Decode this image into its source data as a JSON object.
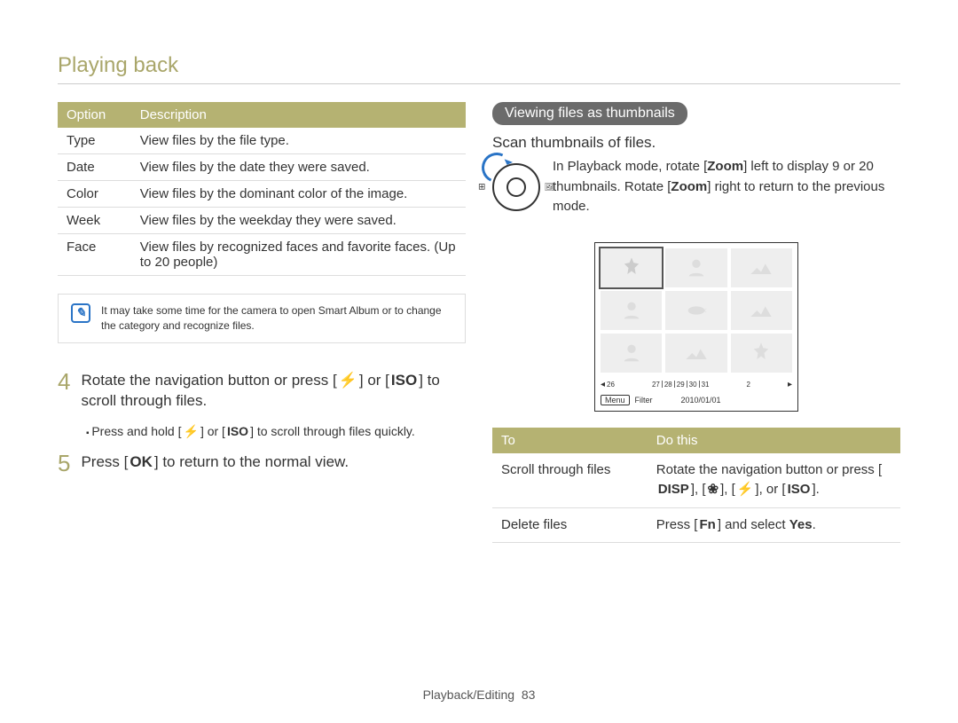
{
  "header": {
    "title": "Playing back"
  },
  "options_table": {
    "headers": [
      "Option",
      "Description"
    ],
    "rows": [
      {
        "option": "Type",
        "desc": "View files by the file type."
      },
      {
        "option": "Date",
        "desc": "View files by the date they were saved."
      },
      {
        "option": "Color",
        "desc": "View files by the dominant color of the image."
      },
      {
        "option": "Week",
        "desc": "View files by the weekday they were saved."
      },
      {
        "option": "Face",
        "desc": "View files by recognized faces and favorite faces. (Up to 20 people)"
      }
    ]
  },
  "note": {
    "icon_glyph": "✎",
    "text": "It may take some time for the camera to open Smart Album or to change the category and recognize files."
  },
  "steps": {
    "s4": {
      "num": "4",
      "pre": "Rotate the navigation button or press [",
      "btn1": "⚡",
      "mid": "] or [",
      "btn2": "ISO",
      "post": "] to scroll through files."
    },
    "s4sub": {
      "pre": "Press and hold [",
      "btn1": "⚡",
      "mid": "] or [",
      "btn2": "ISO",
      "post": "] to scroll through files quickly."
    },
    "s5": {
      "num": "5",
      "pre": "Press [",
      "btn1": "OK",
      "post": "] to return to the normal view."
    }
  },
  "right": {
    "chip": "Viewing files as thumbnails",
    "subtitle": "Scan thumbnails of files.",
    "instr": {
      "pre": "In Playback mode, rotate [",
      "bold1": "Zoom",
      "mid": "] left to display 9 or 20 thumbnails. Rotate [",
      "bold2": "Zoom",
      "post": "] right to return to the previous mode."
    },
    "preview": {
      "timeline": [
        "26",
        "27",
        "28",
        "29",
        "30",
        "31",
        "2"
      ],
      "menu": "Menu",
      "filter": "Filter",
      "date": "2010/01/01"
    },
    "todo_table": {
      "headers": [
        "To",
        "Do this"
      ],
      "rows": {
        "r0": {
          "to": "Scroll through files",
          "pre": "Rotate the navigation button or press [",
          "b1": "DISP",
          "c1": "], [",
          "b2": "❀",
          "c2": "], [",
          "b3": "⚡",
          "c3": "], or [",
          "b4": "ISO",
          "post": "]."
        },
        "r1": {
          "to": "Delete files",
          "pre": "Press [",
          "b1": "Fn",
          "mid": "] and select ",
          "bold": "Yes",
          "post": "."
        }
      }
    }
  },
  "footer": {
    "section": "Playback/Editing",
    "page": "83"
  }
}
